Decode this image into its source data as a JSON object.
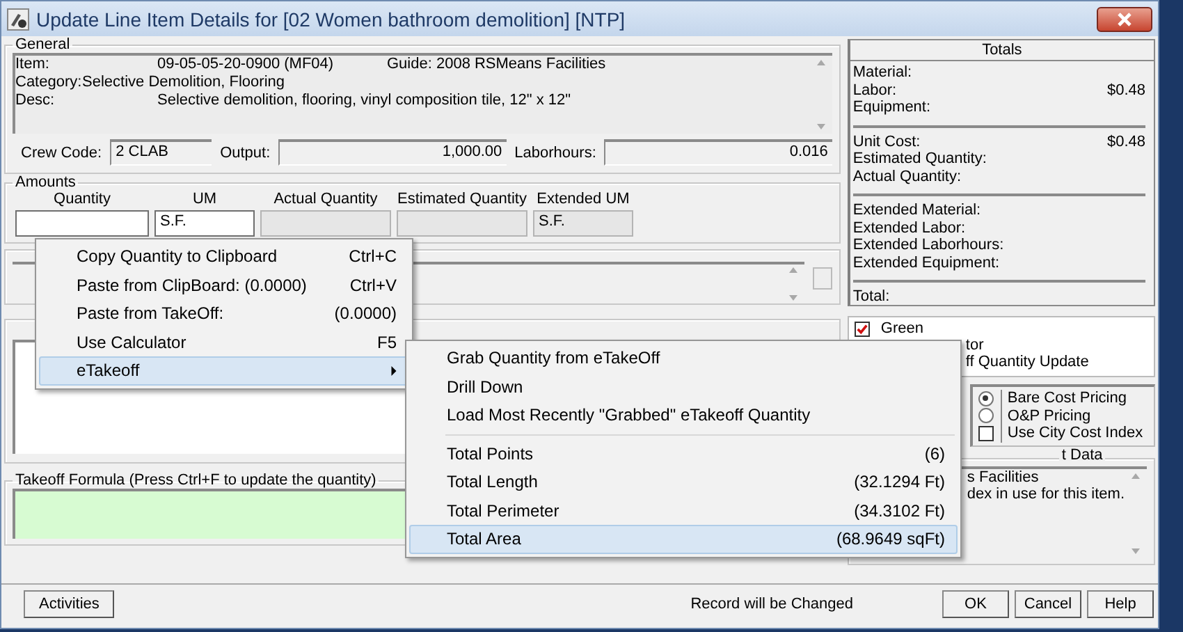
{
  "window": {
    "title": "Update Line Item Details for [02 Women bathroom demolition] [NTP]"
  },
  "general": {
    "label": "General",
    "item_label": "Item:",
    "item": "09-05-05-20-0900 (MF04)",
    "guide": "Guide: 2008 RSMeans Facilities",
    "category_label": "Category:",
    "category": "Selective Demolition, Flooring",
    "desc_label": "Desc:",
    "desc": "Selective demolition, flooring, vinyl composition tile, 12\" x 12\"",
    "crew_code_label": "Crew Code:",
    "crew_code": "2 CLAB",
    "output_label": "Output:",
    "output": "1,000.00",
    "laborhours_label": "Laborhours:",
    "laborhours": "0.016"
  },
  "amounts": {
    "label": "Amounts",
    "fields": [
      {
        "label": "Quantity",
        "editable": true
      },
      {
        "label": "UM",
        "value": "S.F.",
        "editable": true
      },
      {
        "label": "Actual Quantity",
        "editable": false
      },
      {
        "label": "Estimated Quantity",
        "editable": false
      },
      {
        "label": "Extended UM",
        "value": "S.F.",
        "editable": false
      }
    ]
  },
  "takeoff_formula": {
    "label": "Takeoff Formula (Press Ctrl+F to update the quantity)"
  },
  "totals": {
    "title": "Totals",
    "sections": [
      [
        {
          "label": "Material:"
        },
        {
          "label": "Labor:",
          "value": "$0.48"
        },
        {
          "label": "Equipment:"
        }
      ],
      [
        {
          "label": "Unit Cost:",
          "value": "$0.48"
        },
        {
          "label": "Estimated Quantity:"
        },
        {
          "label": "Actual Quantity:"
        }
      ],
      [
        {
          "label": "Extended Material:"
        },
        {
          "label": "Extended Labor:"
        },
        {
          "label": "Extended Laborhours:"
        },
        {
          "label": "Extended Equipment:"
        }
      ],
      [
        {
          "label": "Total:"
        }
      ]
    ]
  },
  "flags": [
    {
      "kind": "checkbox",
      "label": "Green",
      "checked": true
    },
    {
      "kind": "text",
      "label": "tor"
    },
    {
      "kind": "text",
      "label": "ff Quantity Update"
    }
  ],
  "pricing": [
    {
      "kind": "radio",
      "label": "Bare Cost Pricing",
      "selected": true
    },
    {
      "kind": "radio",
      "label": "O&P Pricing",
      "selected": false
    },
    {
      "kind": "checkbox",
      "label": "Use City Cost Index",
      "checked": false
    }
  ],
  "cost_data": {
    "label": "t Data",
    "lines": [
      "s Facilities",
      "dex in use for this item."
    ]
  },
  "status": "Record will be Changed",
  "activities_button": "Activities",
  "buttons": [
    "OK",
    "Cancel",
    "Help"
  ],
  "context_menu": [
    {
      "label": "Copy Quantity to Clipboard",
      "shortcut": "Ctrl+C",
      "selected": false,
      "submenu": false
    },
    {
      "label": "Paste from ClipBoard: (0.0000)",
      "shortcut": "Ctrl+V",
      "selected": false,
      "submenu": false
    },
    {
      "label": "Paste from TakeOff:",
      "shortcut": "(0.0000)",
      "selected": false,
      "submenu": false
    },
    {
      "label": "Use Calculator",
      "shortcut": "F5",
      "selected": false,
      "submenu": false
    },
    {
      "label": "eTakeoff",
      "selected": true,
      "submenu": true
    }
  ],
  "submenu": [
    [
      {
        "label": "Grab Quantity from eTakeOff",
        "selected": false
      },
      {
        "label": "Drill Down",
        "selected": false
      },
      {
        "label": "Load Most Recently \"Grabbed\" eTakeoff Quantity",
        "selected": false
      }
    ],
    [
      {
        "label": "Total Points",
        "value": "(6)",
        "selected": false
      },
      {
        "label": "Total Length",
        "value": "(32.1294 Ft)",
        "selected": false
      },
      {
        "label": "Total Perimeter",
        "value": "(34.3102 Ft)",
        "selected": false
      },
      {
        "label": "Total Area",
        "value": "(68.9649 sqFt)",
        "selected": true
      }
    ]
  ]
}
